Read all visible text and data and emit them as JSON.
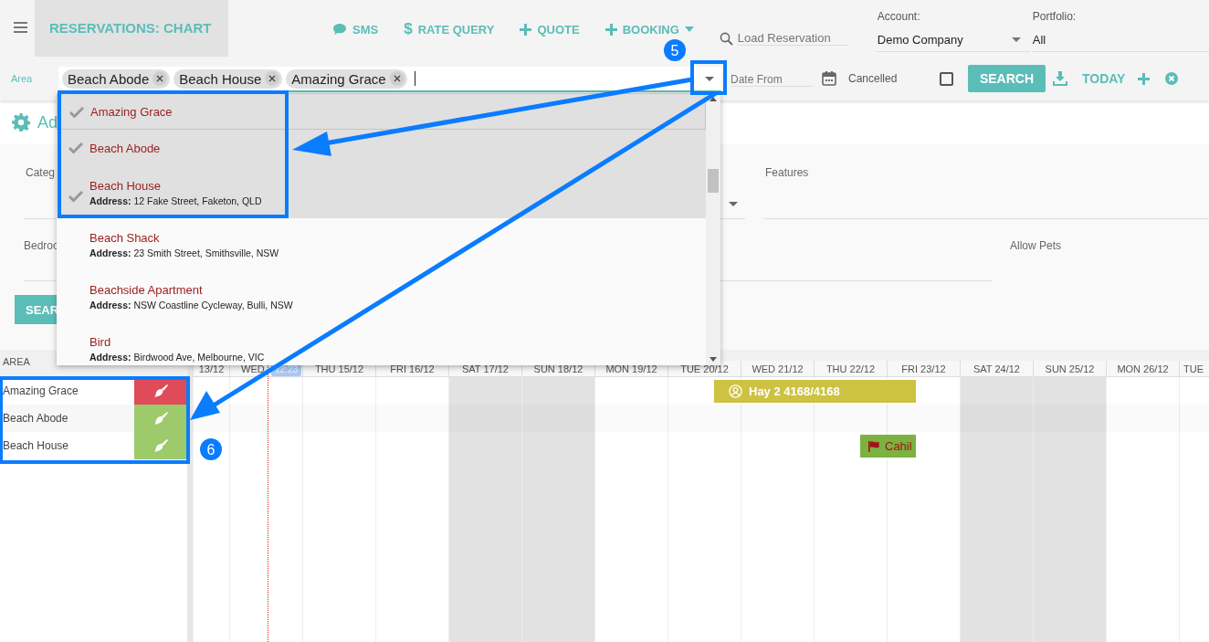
{
  "header": {
    "title": "RESERVATIONS: CHART",
    "nav": [
      {
        "label": "SMS",
        "kind": "chat",
        "menu": false
      },
      {
        "label": "RATE QUERY",
        "kind": "glyph",
        "glyph": "$",
        "menu": false
      },
      {
        "label": "QUOTE",
        "kind": "plus",
        "menu": false
      },
      {
        "label": "BOOKING",
        "kind": "plus",
        "menu": true
      }
    ],
    "search": {
      "placeholder": "Load Reservation"
    },
    "account": {
      "label": "Account:",
      "value": "Demo Company"
    },
    "portfolio": {
      "label": "Portfolio:",
      "value": "All"
    }
  },
  "filters": {
    "area_label": "Area",
    "chips": [
      "Beach Abode",
      "Beach House",
      "Amazing Grace"
    ],
    "date_from": {
      "placeholder": "Date From"
    },
    "cancelled": {
      "label": "Cancelled",
      "checked": false
    },
    "search_button": "SEARCH",
    "today_button": "TODAY"
  },
  "panel": {
    "title": "Ad",
    "category_label": "Categ",
    "bedrooms_label": "Bedroo",
    "features_label": "Features",
    "allow_pets_label": "Allow Pets",
    "search_button": "SEAR"
  },
  "dropdown": {
    "items": [
      {
        "name": "Amazing Grace",
        "selected": true,
        "focused": true
      },
      {
        "name": "Beach Abode",
        "selected": true,
        "focused": false
      },
      {
        "name": "Beach House",
        "address": "**Address:** 12 Fake Street, Faketon, QLD",
        "selected": true,
        "focused": false
      },
      {
        "name": "Beach Shack",
        "address": "**Address:** 23 Smith Street, Smithsville, NSW",
        "selected": false,
        "focused": false
      },
      {
        "name": "Beachside Apartment",
        "address": "**Address:** NSW Coastline Cycleway, Bulli, NSW",
        "selected": false,
        "focused": false
      },
      {
        "name": "Bird",
        "address": "**Address:** Birdwood Ave, Melbourne, VIC",
        "selected": false,
        "focused": false
      }
    ]
  },
  "chart": {
    "area_heading": "AREA",
    "now_badge": "12:23",
    "days": [
      {
        "label": "13/12",
        "weekend": false
      },
      {
        "label": "WED",
        "weekend": false
      },
      {
        "label": "THU 15/12",
        "weekend": false
      },
      {
        "label": "FRI 16/12",
        "weekend": false
      },
      {
        "label": "SAT 17/12",
        "weekend": true
      },
      {
        "label": "SUN 18/12",
        "weekend": true
      },
      {
        "label": "MON 19/12",
        "weekend": false
      },
      {
        "label": "TUE 20/12",
        "weekend": false
      },
      {
        "label": "WED 21/12",
        "weekend": false
      },
      {
        "label": "THU 22/12",
        "weekend": false
      },
      {
        "label": "FRI 23/12",
        "weekend": false
      },
      {
        "label": "SAT 24/12",
        "weekend": true
      },
      {
        "label": "SUN 25/12",
        "weekend": true
      },
      {
        "label": "MON 26/12",
        "weekend": false
      },
      {
        "label": "TUE",
        "weekend": false
      }
    ],
    "rows": [
      {
        "name": "Amazing Grace",
        "color": "#e04b59",
        "bookings": [
          {
            "label": "Hay 2 4168/4168",
            "kind": "guest",
            "color": "#cdc241"
          }
        ]
      },
      {
        "name": "Beach Abode",
        "color": "#9dca6a",
        "bookings": []
      },
      {
        "name": "Beach House",
        "color": "#9dca6a",
        "bookings": [
          {
            "label": "Cahil",
            "kind": "flag",
            "color": "#7bb241"
          }
        ]
      }
    ]
  },
  "annotations": {
    "steps": [
      "5",
      "6"
    ]
  }
}
